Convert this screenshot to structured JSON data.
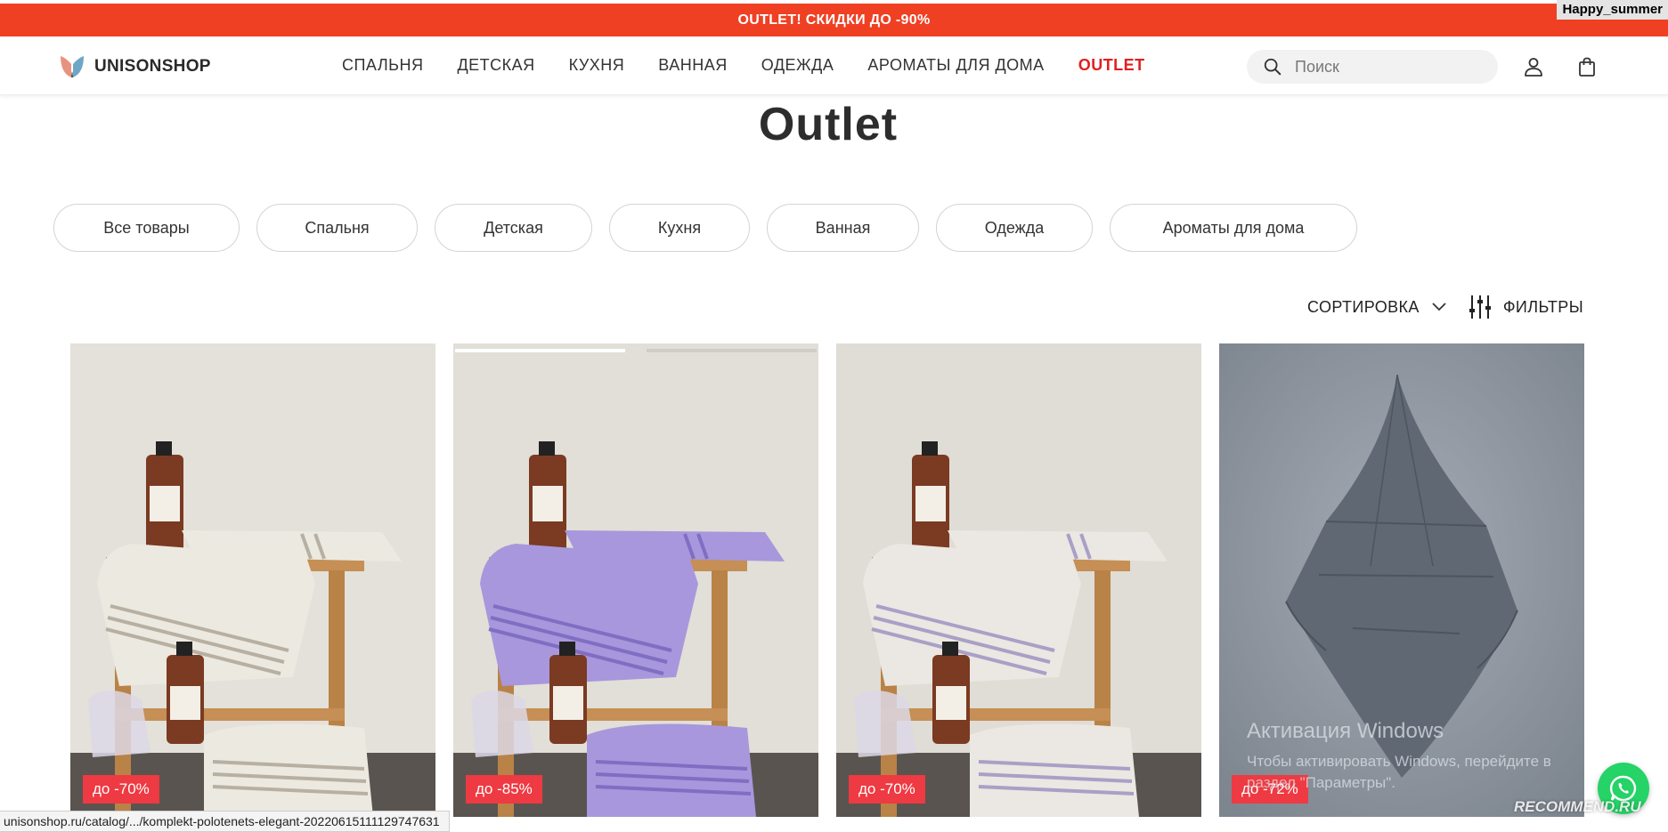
{
  "promo": {
    "text": "OUTLET! СКИДКИ ДО -90%",
    "background": "#ef4023"
  },
  "user_tag": "Happy_summer",
  "header": {
    "logo_text": "UNISONSHOP",
    "nav": [
      {
        "label": "СПАЛЬНЯ"
      },
      {
        "label": "ДЕТСКАЯ"
      },
      {
        "label": "КУХНЯ"
      },
      {
        "label": "ВАННАЯ"
      },
      {
        "label": "ОДЕЖДА"
      },
      {
        "label": "АРОМАТЫ ДЛЯ ДОМА"
      },
      {
        "label": "OUTLET",
        "active": true,
        "color": "#e02020"
      }
    ],
    "search_placeholder": "Поиск",
    "icons": [
      "search-icon",
      "user-icon",
      "bag-icon"
    ]
  },
  "page_title": "Outlet",
  "categories": [
    {
      "label": "Все товары"
    },
    {
      "label": "Спальня"
    },
    {
      "label": "Детская"
    },
    {
      "label": "Кухня"
    },
    {
      "label": "Ванная"
    },
    {
      "label": "Одежда"
    },
    {
      "label": "Ароматы для дома"
    }
  ],
  "toolbar": {
    "sort_label": "СОРТИРОВКА",
    "filters_label": "ФИЛЬТРЫ"
  },
  "products": [
    {
      "discount": "до -70%",
      "towel_color": "#ece9e0",
      "stripe_color": "#b7b0a2"
    },
    {
      "discount": "до -85%",
      "towel_color": "#a897dc",
      "stripe_color": "#7f6ec2"
    },
    {
      "discount": "до -70%",
      "towel_color": "#ebe7e2",
      "stripe_color": "#a9a0c7"
    },
    {
      "discount": "до -72%",
      "fabric_color": "#5f6873"
    }
  ],
  "badge_color": "#ee3a42",
  "windows_watermark": {
    "title": "Активация Windows",
    "subtitle": "Чтобы активировать Windows, перейдите в раздел \"Параметры\"."
  },
  "status_url": "unisonshop.ru/catalog/.../komplekt-polotenets-elegant-20220615111129747631",
  "recommend_mark": "RECOMMEND.RU"
}
